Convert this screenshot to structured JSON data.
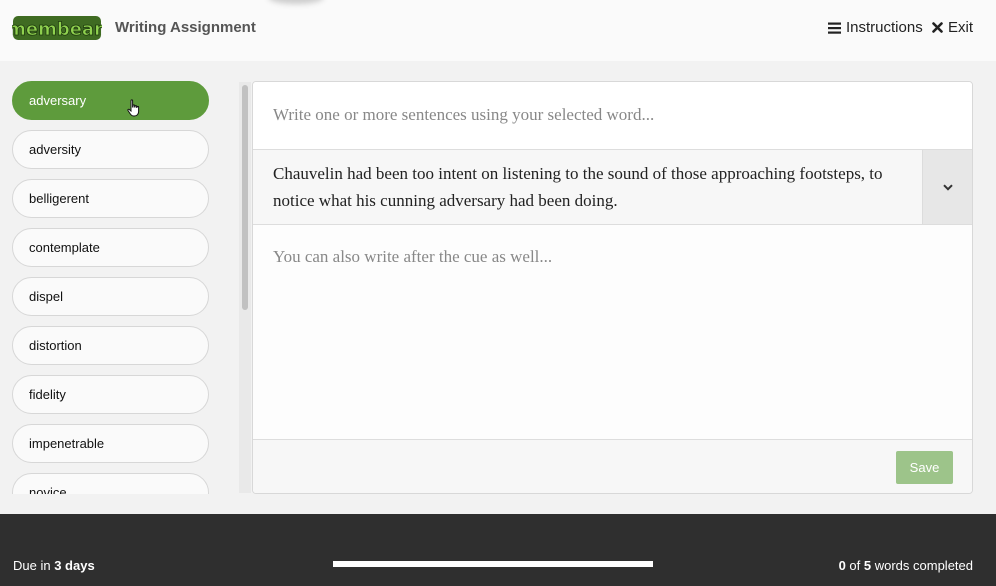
{
  "header": {
    "logo_text": "membean",
    "title": "Writing Assignment",
    "instructions_label": "Instructions",
    "exit_label": "Exit"
  },
  "words": [
    {
      "label": "adversary",
      "active": true
    },
    {
      "label": "adversity"
    },
    {
      "label": "belligerent"
    },
    {
      "label": "contemplate"
    },
    {
      "label": "dispel"
    },
    {
      "label": "distortion"
    },
    {
      "label": "fidelity"
    },
    {
      "label": "impenetrable"
    },
    {
      "label": "novice"
    }
  ],
  "editor": {
    "before_placeholder": "Write one or more sentences using your selected word...",
    "cue_text": "Chauvelin had been too intent on listening to the sound of those approaching footsteps, to notice what his cunning adversary had been doing.",
    "after_placeholder": "You can also write after the cue as well...",
    "save_label": "Save"
  },
  "status": {
    "due_prefix": "Due in ",
    "due_value": "3 days",
    "completed": "0",
    "of_text": " of ",
    "total": "5",
    "suffix": " words completed",
    "progress_fraction": 0
  },
  "colors": {
    "accent": "#5e9b3c",
    "save_disabled": "#9dc48a",
    "status_bar": "#2f2f2f"
  }
}
